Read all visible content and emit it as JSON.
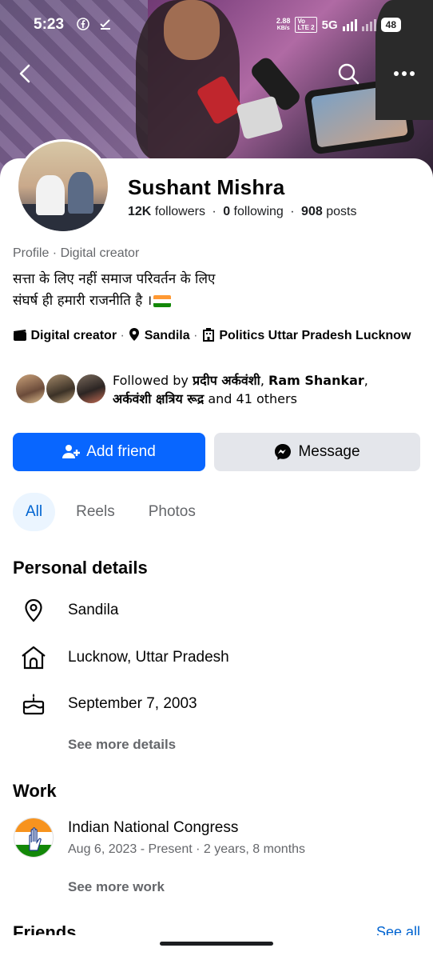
{
  "status_bar": {
    "time": "5:23",
    "net_speed_top": "2.88",
    "net_speed_unit": "KB/s",
    "volte_top": "Vo",
    "volte_bottom": "LTE 2",
    "network": "5G",
    "battery": "48"
  },
  "cover_photo": {
    "description_icon": "cover-photo"
  },
  "profile": {
    "name": "Sushant Mishra",
    "followers_count": "12K",
    "followers_label": "followers",
    "following_count": "0",
    "following_label": "following",
    "posts_count": "908",
    "posts_label": "posts",
    "meta": "Profile · Digital creator",
    "bio_line1": "सत्ता के लिए नहीं समाज परिवर्तन  के लिए",
    "bio_line2": "संघर्ष ही हमारी राजनीति है ।",
    "category": "Digital creator",
    "location": "Sandila",
    "page_info": "Politics Uttar Pradesh Lucknow"
  },
  "followed_by": {
    "prefix": "Followed by ",
    "name1": "प्रदीप अर्कवंशी",
    "sep1": ", ",
    "name2": "Ram Shankar",
    "sep2": ",",
    "name3": "अर्कवंशी क्षत्रिय रूद्र",
    "suffix": " and 41 others"
  },
  "actions": {
    "add_friend": "Add friend",
    "message": "Message"
  },
  "tabs": [
    {
      "label": "All",
      "active": true
    },
    {
      "label": "Reels",
      "active": false
    },
    {
      "label": "Photos",
      "active": false
    }
  ],
  "personal_details": {
    "heading": "Personal details",
    "items": [
      {
        "icon": "location-pin-icon",
        "text": "Sandila"
      },
      {
        "icon": "home-icon",
        "text": "Lucknow, Uttar Pradesh"
      },
      {
        "icon": "birthday-cake-icon",
        "text": "September 7, 2003"
      }
    ],
    "see_more": "See more details"
  },
  "work": {
    "heading": "Work",
    "employer": "Indian National Congress",
    "period": "Aug 6, 2023 - Present · 2 years, 8 months",
    "see_more": "See more work"
  },
  "friends": {
    "heading": "Friends",
    "see_all": "See all"
  },
  "colors": {
    "primary_blue": "#0866ff",
    "link_blue": "#0064d1",
    "secondary_button": "#e4e6eb",
    "muted_text": "#65676b",
    "tab_active_bg": "#ebf5ff"
  }
}
